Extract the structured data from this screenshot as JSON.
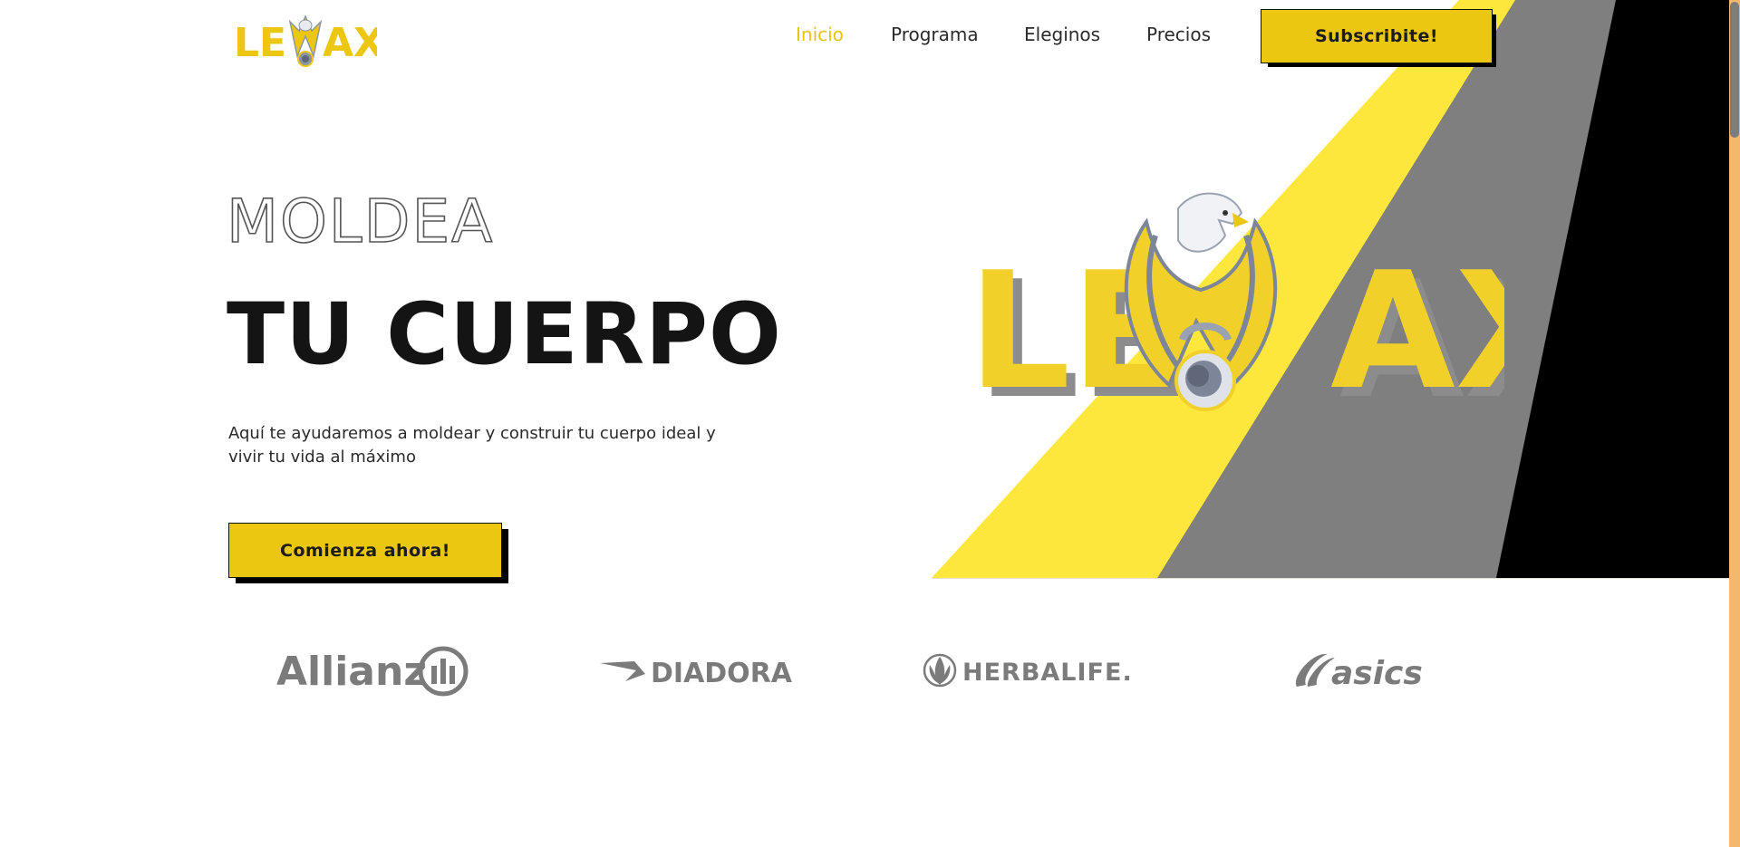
{
  "brand": {
    "logo_text_left": "LE",
    "logo_text_right": "AX",
    "colors": {
      "yellow": "#ecc712",
      "stripe_yellow": "#fde73c",
      "gray": "#7f7f7f",
      "black": "#000000"
    }
  },
  "nav": {
    "items": [
      {
        "label": "Inicio",
        "active": true
      },
      {
        "label": "Programa",
        "active": false
      },
      {
        "label": "Eleginos",
        "active": false
      },
      {
        "label": "Precios",
        "active": false
      }
    ],
    "cta_label": "Subscribite!"
  },
  "hero": {
    "line1": "MOLDEA",
    "line2": "TU CUERPO",
    "subtitle": "Aquí te ayudaremos a moldear y construir tu cuerpo ideal y vivir tu vida al máximo",
    "cta_label": "Comienza ahora!"
  },
  "sponsors": [
    {
      "name": "Allianz",
      "icon": "allianz-emblem-icon"
    },
    {
      "name": "DIADORA",
      "icon": "diadora-arrow-icon"
    },
    {
      "name": "HERBALIFE.",
      "icon": "herbalife-leaf-icon"
    },
    {
      "name": "asics",
      "icon": "asics-stripe-icon"
    }
  ]
}
